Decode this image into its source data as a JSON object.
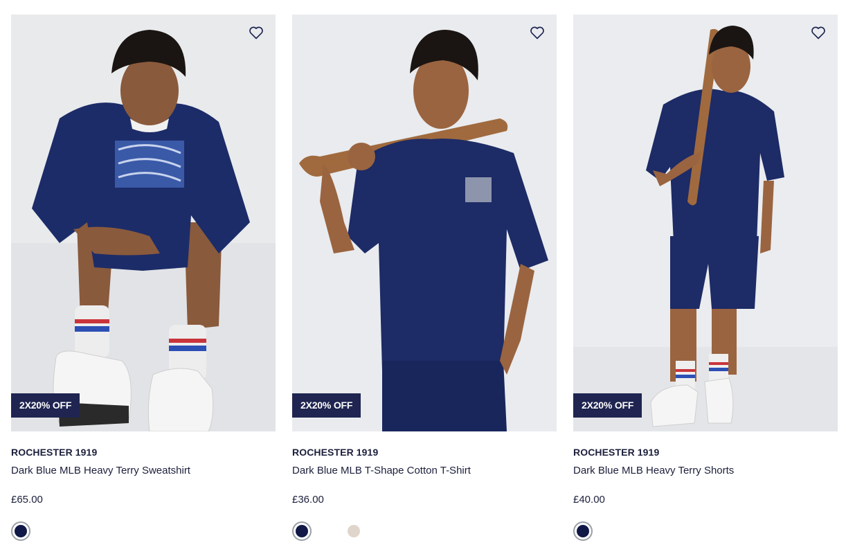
{
  "colors": {
    "badge_bg": "#1f2550",
    "text": "#1b1f3b",
    "navy": "#0f1846",
    "stone": "#dfd5cb"
  },
  "products": [
    {
      "brand": "ROCHESTER 1919",
      "name": "Dark Blue MLB Heavy Terry Sweatshirt",
      "price": "£65.00",
      "badge": "2X20% OFF",
      "wishlist_icon": "heart-outline-icon",
      "swatches": [
        {
          "color": "#0f1846",
          "selected": true
        }
      ]
    },
    {
      "brand": "ROCHESTER 1919",
      "name": "Dark Blue MLB T-Shape Cotton T-Shirt",
      "price": "£36.00",
      "badge": "2X20% OFF",
      "wishlist_icon": "heart-outline-icon",
      "swatches": [
        {
          "color": "#0f1846",
          "selected": true
        },
        {
          "color": "#dfd5cb",
          "selected": false
        }
      ]
    },
    {
      "brand": "ROCHESTER 1919",
      "name": "Dark Blue MLB Heavy Terry Shorts",
      "price": "£40.00",
      "badge": "2X20% OFF",
      "wishlist_icon": "heart-outline-icon",
      "swatches": [
        {
          "color": "#0f1846",
          "selected": true
        }
      ]
    }
  ]
}
